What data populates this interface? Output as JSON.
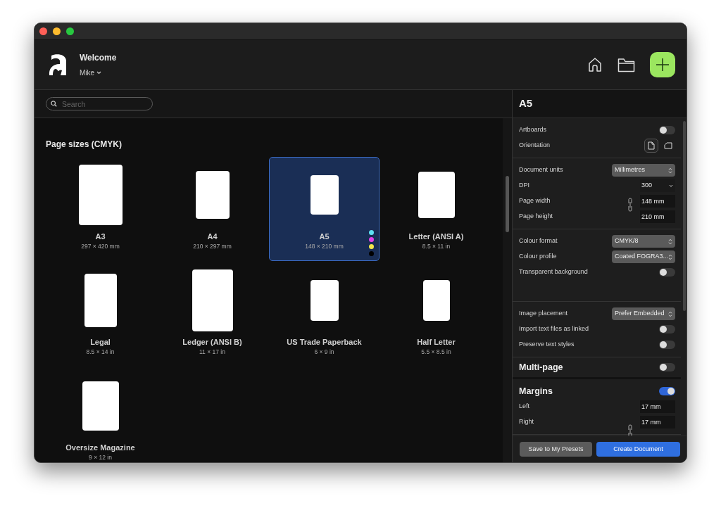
{
  "header": {
    "title": "Welcome",
    "user": "Mike"
  },
  "search": {
    "placeholder": "Search"
  },
  "presets": {
    "heading": "Page sizes (CMYK)",
    "items": [
      {
        "name": "A3",
        "size": "297 × 420 mm",
        "selected": false
      },
      {
        "name": "A4",
        "size": "210 × 297 mm",
        "selected": false
      },
      {
        "name": "A5",
        "size": "148 × 210 mm",
        "selected": true,
        "dots": [
          {
            "color": "#5ee0f2"
          },
          {
            "color": "#e040e8"
          },
          {
            "color": "#f2e64a"
          },
          {
            "color": "#000000"
          }
        ]
      },
      {
        "name": "Letter (ANSI A)",
        "size": "8.5 × 11 in",
        "selected": false
      },
      {
        "name": "Legal",
        "size": "8.5 × 14 in",
        "selected": false
      },
      {
        "name": "Ledger (ANSI B)",
        "size": "11 × 17 in",
        "selected": false
      },
      {
        "name": "US Trade Paperback",
        "size": "6 × 9 in",
        "selected": false
      },
      {
        "name": "Half Letter",
        "size": "5.5 × 8.5 in",
        "selected": false
      },
      {
        "name": "Oversize Magazine",
        "size": "9 × 12 in",
        "selected": false
      }
    ]
  },
  "inspector": {
    "title": "A5",
    "sections": [
      {
        "linked": false,
        "rows": [
          {
            "kind": "toggle",
            "label": "Artboards",
            "on": false
          },
          {
            "kind": "orientation",
            "label": "Orientation",
            "options": [
              {
                "kind": "portrait",
                "selected": true
              },
              {
                "kind": "landscape",
                "selected": false
              }
            ]
          }
        ]
      },
      {
        "linked": true,
        "rows": [
          {
            "kind": "select",
            "label": "Document units",
            "value": "Millimetres"
          },
          {
            "kind": "dropdown",
            "label": "DPI",
            "value": "300"
          },
          {
            "kind": "field",
            "label": "Page width",
            "value": "148 mm"
          },
          {
            "kind": "field",
            "label": "Page height",
            "value": "210 mm"
          }
        ]
      },
      {
        "linked": false,
        "rows": [
          {
            "kind": "select",
            "label": "Colour format",
            "value": "CMYK/8"
          },
          {
            "kind": "select",
            "label": "Colour profile",
            "value": "Coated FOGRA3..."
          },
          {
            "kind": "toggle",
            "label": "Transparent background",
            "on": false
          }
        ]
      },
      {
        "linked": false,
        "rows": [
          {
            "kind": "select",
            "label": "Image placement",
            "value": "Prefer Embedded"
          },
          {
            "kind": "toggle",
            "label": "Import text files as linked",
            "on": false
          },
          {
            "kind": "toggle",
            "label": "Preserve text styles",
            "on": false
          }
        ]
      },
      {
        "linked": false,
        "rows": [
          {
            "kind": "heading",
            "label": "Multi-page",
            "on": false
          }
        ]
      },
      {
        "linked": true,
        "rows": [
          {
            "kind": "heading",
            "label": "Margins",
            "on": true
          },
          {
            "kind": "field",
            "label": "Left",
            "value": "17 mm"
          },
          {
            "kind": "field",
            "label": "Right",
            "value": "17 mm"
          }
        ]
      }
    ],
    "buttons": [
      {
        "kind": "secondary",
        "label": "Save to My Presets"
      },
      {
        "kind": "primary",
        "label": "Create Document"
      }
    ]
  }
}
